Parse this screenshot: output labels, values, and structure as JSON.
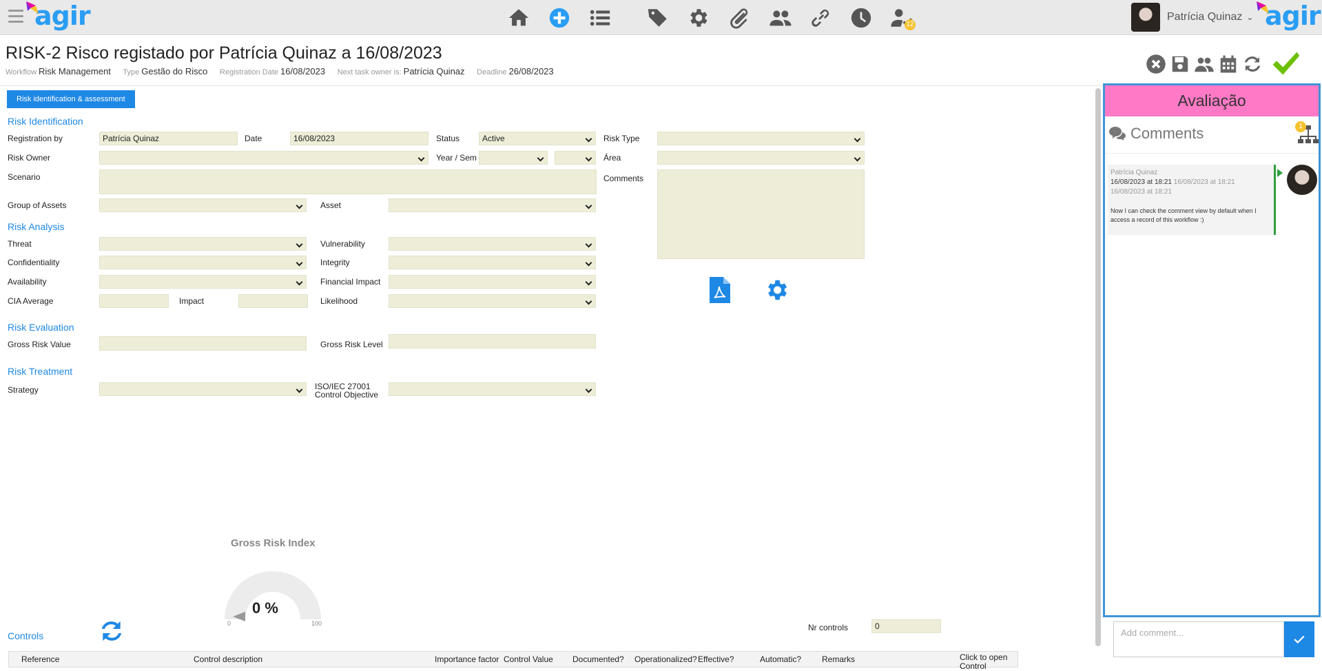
{
  "app": {
    "logo_text": "agir",
    "user_name": "Patrícia Quinaz",
    "user_badge": "12",
    "colors": {
      "accent": "#1e88e5",
      "field_bg": "#eeeed8",
      "panel_header": "#ff79c6",
      "panel_border": "#3f94d6",
      "confirm": "#6cc000"
    }
  },
  "topnav": {
    "icons": [
      "home-icon",
      "add-circle-icon",
      "list-icon",
      "tags-icon",
      "settings-gear-icon",
      "paperclip-icon",
      "users-icon",
      "link-icon",
      "clock-icon",
      "user-check-icon"
    ]
  },
  "record": {
    "title": "RISK-2 Risco registado por Patrícia Quinaz a 16/08/2023",
    "meta": {
      "workflow_label": "Workflow",
      "workflow_value": "Risk Management",
      "type_label": "Type",
      "type_value": "Gestão do Risco",
      "regdate_label": "Registration Date",
      "regdate_value": "16/08/2023",
      "owner_label": "Next task owner is:",
      "owner_value": "Patrícia Quinaz",
      "deadline_label": "Deadline",
      "deadline_value": "26/08/2023"
    }
  },
  "actions": [
    "close-icon",
    "save-icon",
    "participants-icon",
    "calendar-icon",
    "refresh-icon",
    "confirm-check-icon"
  ],
  "tab": {
    "label": "Risk identification & assessment"
  },
  "form": {
    "sections": {
      "identification": "Risk Identification",
      "analysis": "Risk Analysis",
      "evaluation": "Risk Evaluation",
      "treatment": "Risk Treatment",
      "controls": "Controls"
    },
    "labels": {
      "registration_by": "Registration by",
      "date": "Date",
      "status": "Status",
      "risk_type": "Risk Type",
      "risk_owner": "Risk Owner",
      "year_sem": "Year / Sem",
      "area": "Área",
      "scenario": "Scenario",
      "comments": "Comments",
      "group_assets": "Group of Assets",
      "asset": "Asset",
      "threat": "Threat",
      "vulnerability": "Vulnerability",
      "confidentiality": "Confidentiality",
      "integrity": "Integrity",
      "availability": "Availability",
      "financial_impact": "Financial Impact",
      "cia_average": "CIA Average",
      "impact": "Impact",
      "likelihood": "Likelihood",
      "gross_risk_value": "Gross Risk Value",
      "gross_risk_level": "Gross Risk Level",
      "strategy": "Strategy",
      "iso_line1": "ISO/IEC 27001",
      "iso_line2": "Control Objective",
      "nr_controls": "Nr controls"
    },
    "values": {
      "registration_by": "Patrícia Quinaz",
      "date": "16/08/2023",
      "status": "Active",
      "nr_controls": "0"
    }
  },
  "gauge": {
    "title": "Gross Risk Index",
    "value": "0 %",
    "min": "0",
    "max": "100",
    "fraction": 0
  },
  "controls_table": {
    "columns": [
      "Reference",
      "Control description",
      "Importance factor",
      "Control Value",
      "Documented?",
      "Operationalized?",
      "Effective?",
      "Automatic?",
      "Remarks",
      "Click to open Control"
    ]
  },
  "panel": {
    "header": "Avaliação",
    "comments_title": "Comments",
    "tree_badge": "1",
    "comment": {
      "author": "Patrícia Quinaz",
      "date_main": "16/08/2023 at 18:21",
      "date_grey": "16/08/2023 at 18:21 16/08/2023 at 18:21",
      "text": "Now I can check the comment view by default when I access a record of this workflow :)"
    },
    "add_placeholder": "Add comment..."
  }
}
